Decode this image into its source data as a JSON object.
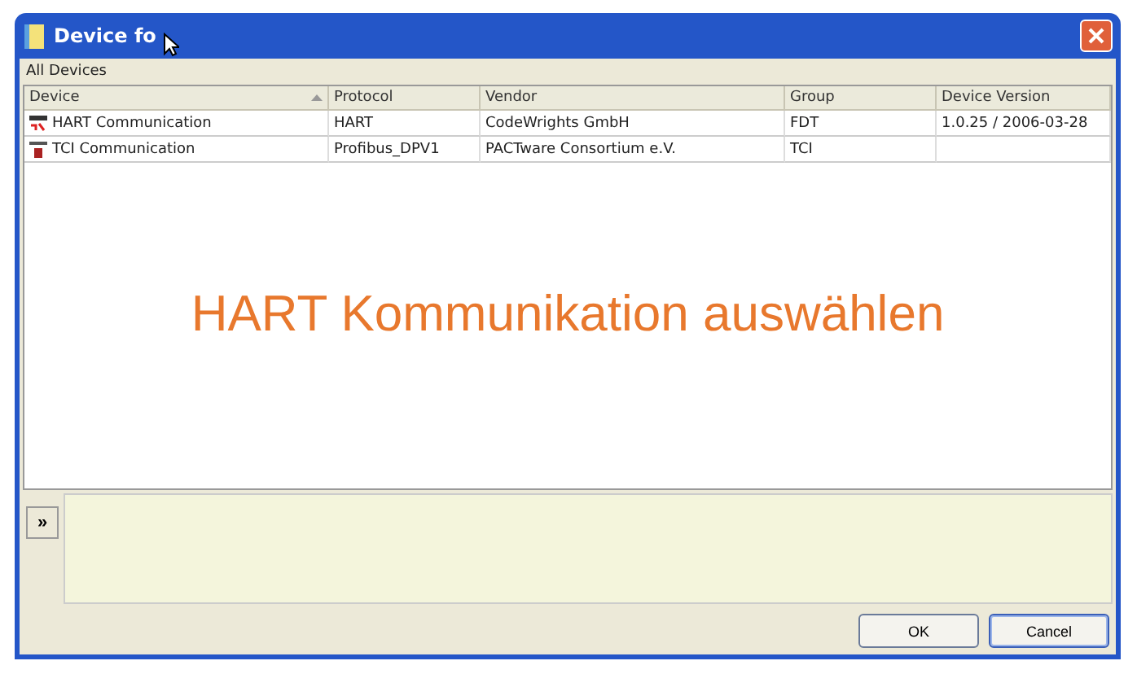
{
  "window": {
    "title": "Device fo"
  },
  "panel_title": "All Devices",
  "table": {
    "columns": [
      {
        "label": "Device",
        "sorted": true
      },
      {
        "label": "Protocol",
        "sorted": false
      },
      {
        "label": "Vendor",
        "sorted": false
      },
      {
        "label": "Group",
        "sorted": false
      },
      {
        "label": "Device Version",
        "sorted": false
      }
    ],
    "rows": [
      {
        "kind": "hart",
        "cells": [
          "HART Communication",
          "HART",
          "CodeWrights GmbH",
          "FDT",
          "1.0.25 / 2006-03-28"
        ]
      },
      {
        "kind": "tci",
        "cells": [
          "TCI Communication",
          "Profibus_DPV1",
          "PACTware Consortium e.V.",
          "TCI",
          ""
        ]
      }
    ]
  },
  "annotation": "HART Kommunikation auswählen",
  "expand_button": {
    "label": "»"
  },
  "buttons": [
    {
      "label": "OK",
      "default": false
    },
    {
      "label": "Cancel",
      "default": true
    }
  ]
}
